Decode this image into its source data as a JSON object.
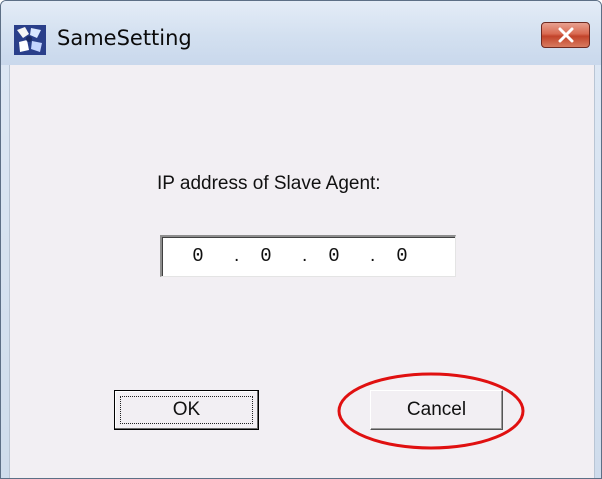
{
  "window": {
    "title": "SameSetting"
  },
  "titlebar": {
    "icon": "app-icon",
    "close_icon": "close-icon"
  },
  "dialog": {
    "ip_label": "IP address of Slave Agent:",
    "ip_octets": [
      "0",
      "0",
      "0",
      "0"
    ],
    "ip_separator": "."
  },
  "buttons": {
    "ok_label": "OK",
    "cancel_label": "Cancel"
  },
  "annotation": {
    "shape": "ellipse",
    "color": "#e01010",
    "target": "cancel-button"
  },
  "colors": {
    "client_bg": "#f2eff3",
    "close_red": "#c2432a"
  }
}
